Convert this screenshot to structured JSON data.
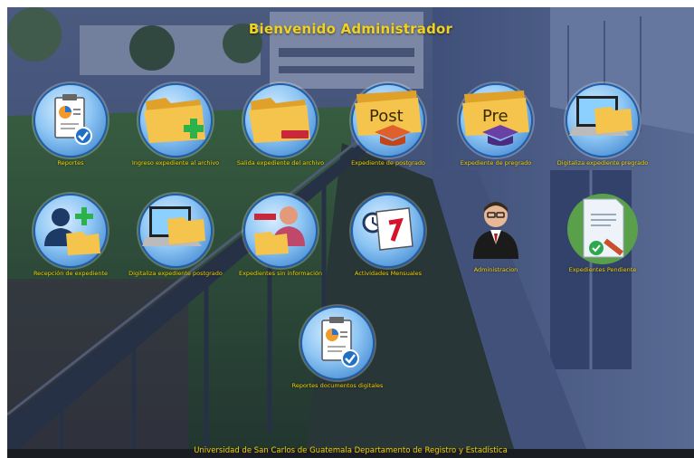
{
  "header": {
    "title": "Bienvenido Administrador"
  },
  "tiles": [
    {
      "label": "Reportes",
      "icon": "report-chart-icon"
    },
    {
      "label": "Ingreso expediente al archivo",
      "icon": "folder-add-icon"
    },
    {
      "label": "Salida expediente del archivo",
      "icon": "folder-remove-icon"
    },
    {
      "label": "Expediente de postgrado",
      "icon": "folder-post-icon"
    },
    {
      "label": "Expediente de pregrado",
      "icon": "folder-pre-icon"
    },
    {
      "label": "Digitaliza expediente pregrado",
      "icon": "laptop-folder-icon"
    },
    {
      "label": "Recepción de expediente",
      "icon": "user-folder-add-icon"
    },
    {
      "label": "Digitaliza expediente postgrado",
      "icon": "laptop-folder-icon"
    },
    {
      "label": "Expedientes sin información",
      "icon": "user-folder-remove-icon"
    },
    {
      "label": "Actividades Mensuales",
      "icon": "calendar-clock-icon"
    },
    {
      "label": "Administracion",
      "icon": "admin-user-icon"
    },
    {
      "label": "Expedientes Pendiente",
      "icon": "document-pending-icon"
    },
    {
      "label": "Reportes documentos digitales",
      "icon": "report-chart-icon"
    }
  ],
  "footer": {
    "text": "Universidad de San Carlos de Guatemala Departamento de Registro y Estadística"
  },
  "colors": {
    "label": "#f0d000",
    "overlay": "#1e2a55",
    "circle": "#2e77c8"
  }
}
